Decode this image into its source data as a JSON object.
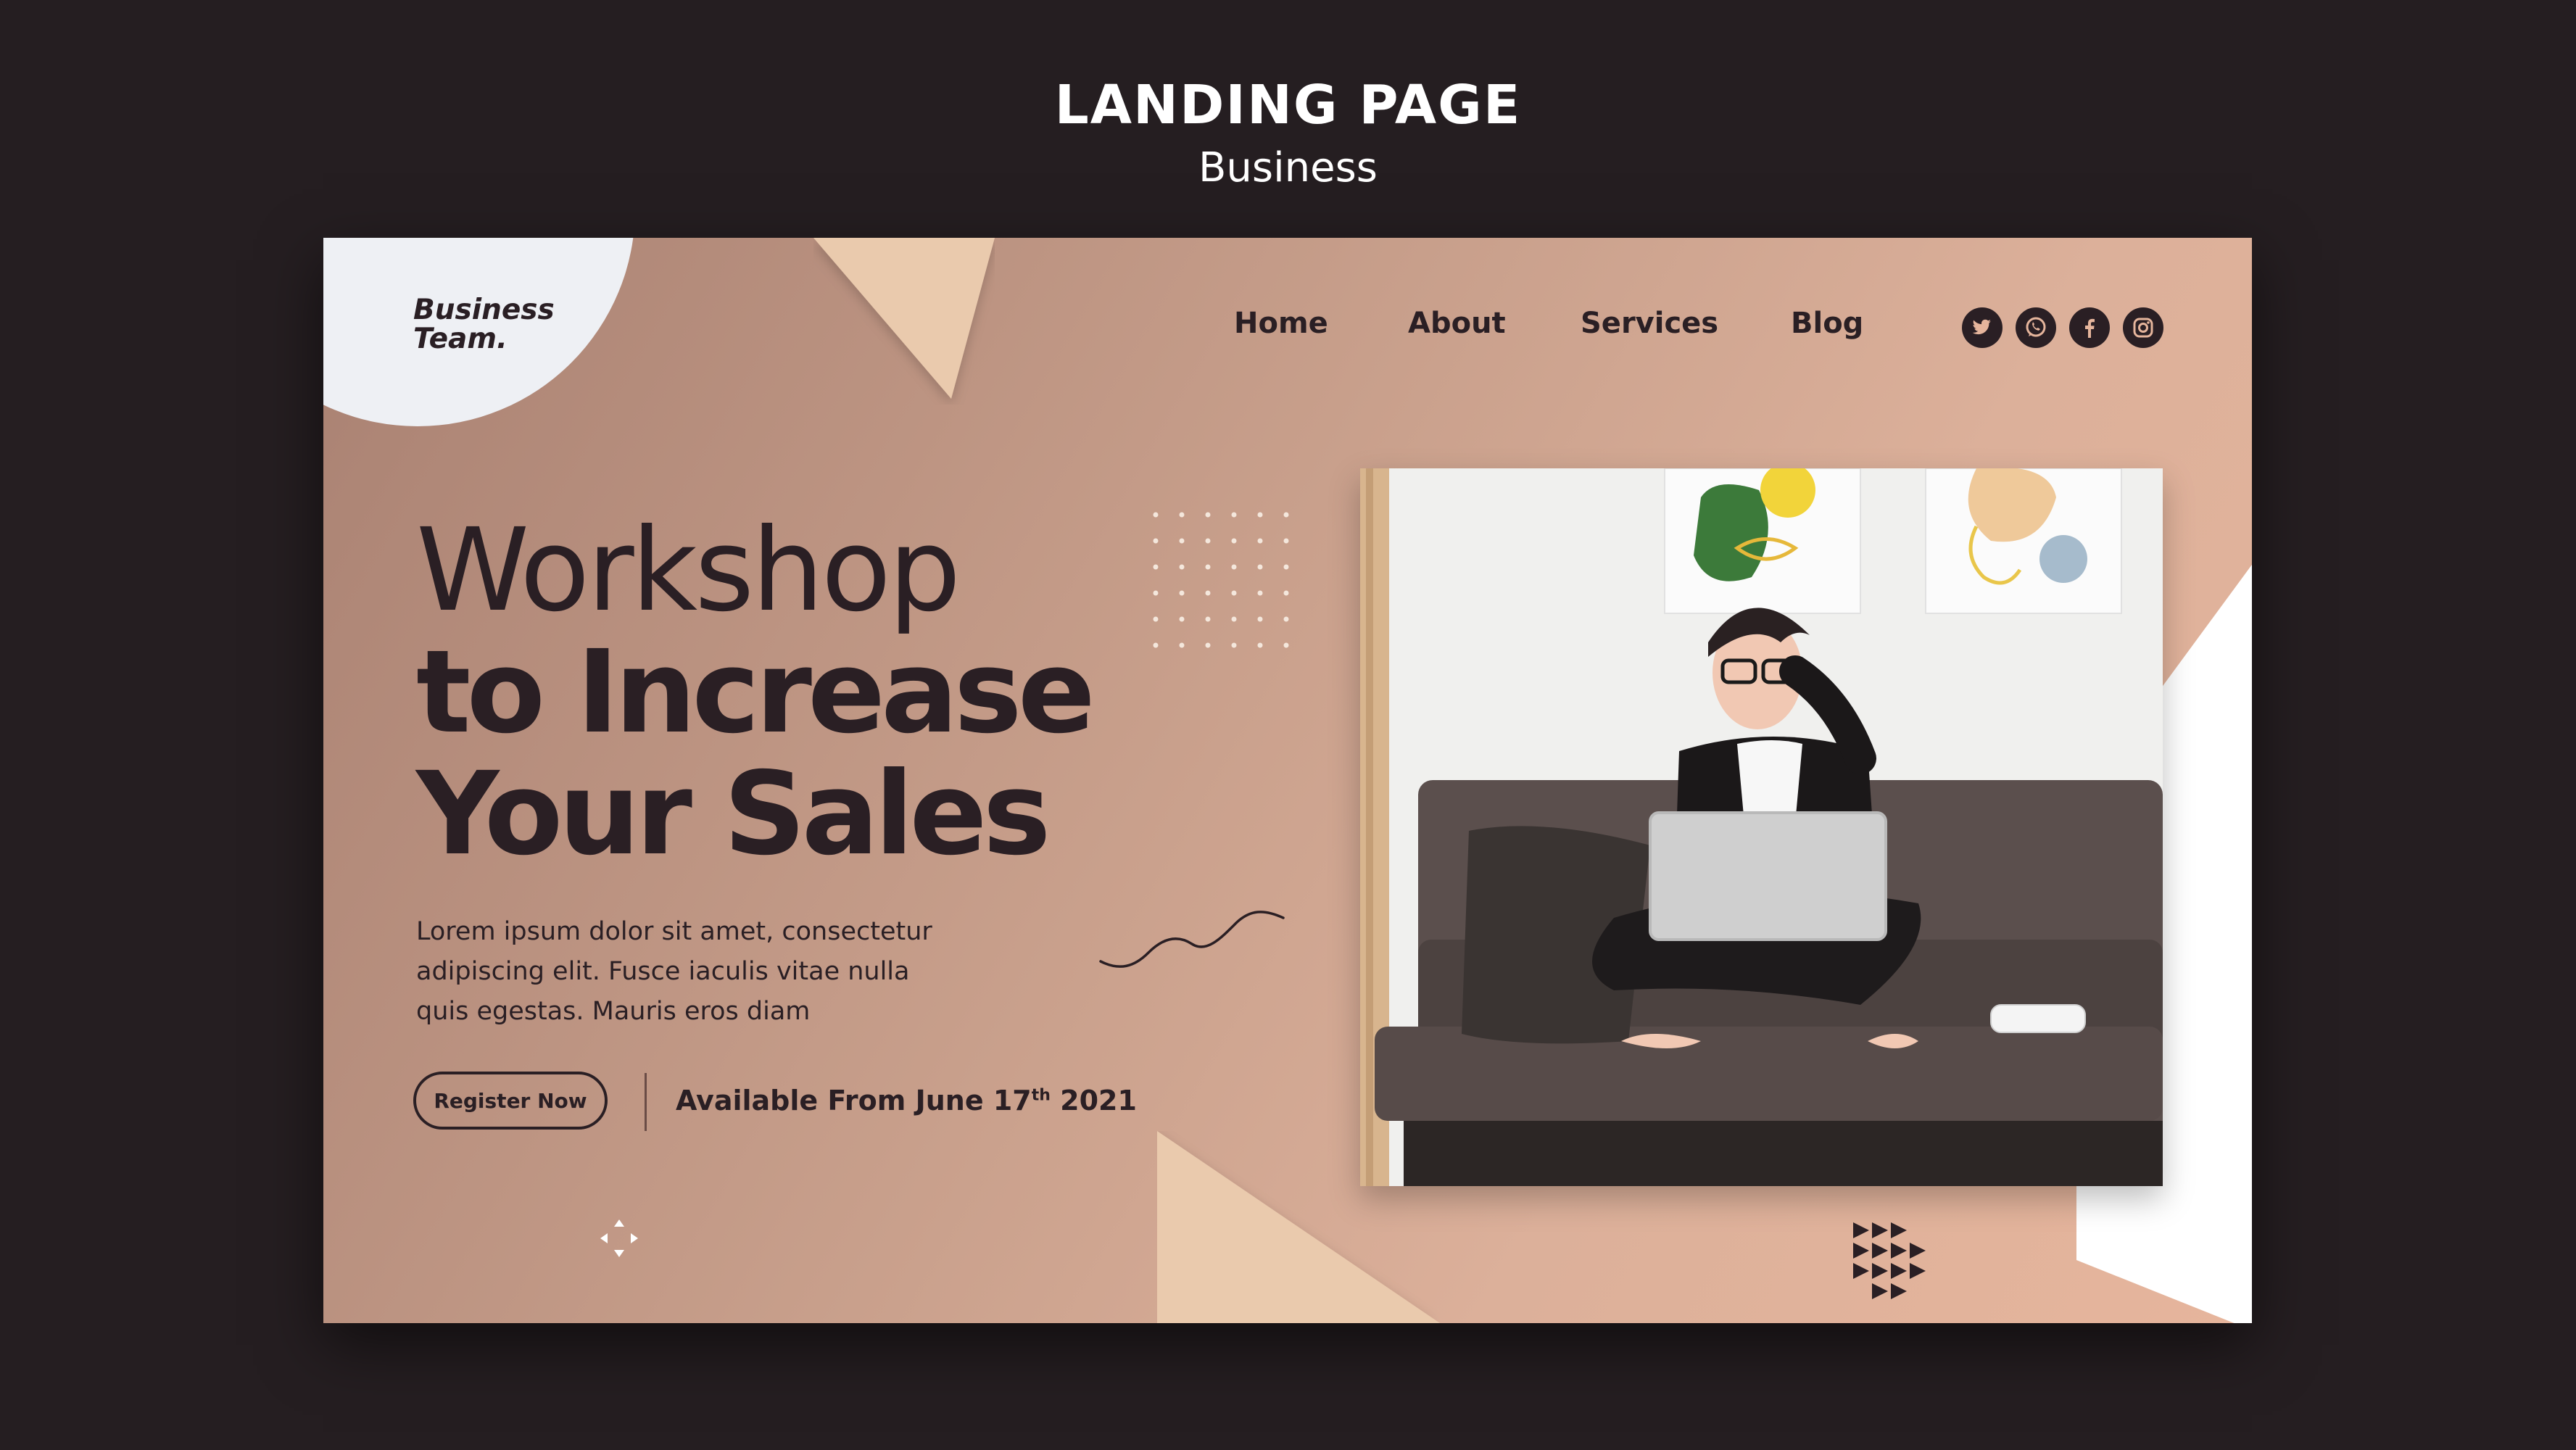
{
  "page": {
    "title": "LANDING PAGE",
    "subtitle": "Business"
  },
  "logo": {
    "line1": "Business",
    "line2": "Team."
  },
  "nav": {
    "items": [
      "Home",
      "About",
      "Services",
      "Blog"
    ]
  },
  "social": {
    "icons": [
      "twitter-icon",
      "whatsapp-icon",
      "facebook-icon",
      "instagram-icon"
    ]
  },
  "hero": {
    "headline_line1": "Workshop",
    "headline_line2": "to Increase",
    "headline_line3": "Your Sales",
    "body": "Lorem ipsum dolor sit amet, consectetur adipiscing elit. Fusce iaculis vitae nulla quis egestas. Mauris eros diam",
    "cta_label": "Register Now",
    "availability_prefix": "Available From June 17",
    "availability_sup": "th",
    "availability_suffix": " 2021"
  },
  "colors": {
    "background": "#251e21",
    "card_start": "#a98172",
    "card_end": "#e6b59c",
    "dark_text": "#2a1f24",
    "accent_light": "#eacaad",
    "logo_blob": "#eef0f4"
  }
}
